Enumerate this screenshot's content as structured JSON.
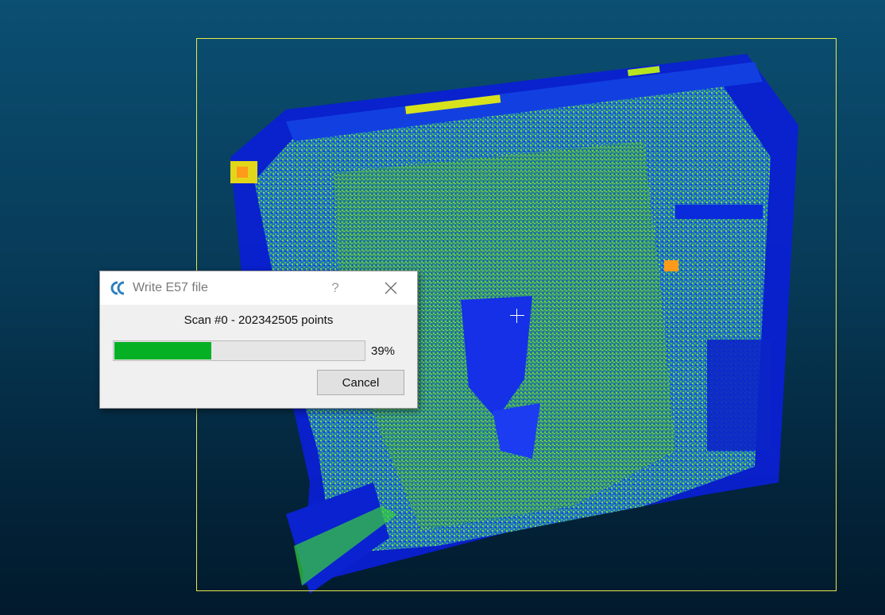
{
  "dialog": {
    "title": "Write E57 file",
    "help_label": "?",
    "status": "Scan #0 - 202342505 points",
    "progress": {
      "value_fraction": 0.39,
      "label": "39%"
    },
    "cancel_label": "Cancel",
    "icons": {
      "app": "cloudcompare-logo-icon",
      "close": "close-icon"
    }
  },
  "viewport": {
    "background_top": "#0b4f72",
    "background_bottom": "#021a2c",
    "bbox_color": "#e8e84a",
    "colormap": [
      "#0018ff",
      "#0050ff",
      "#1a9a4a",
      "#3fcf3f",
      "#9be22b",
      "#ffe000",
      "#ff6a00"
    ]
  }
}
